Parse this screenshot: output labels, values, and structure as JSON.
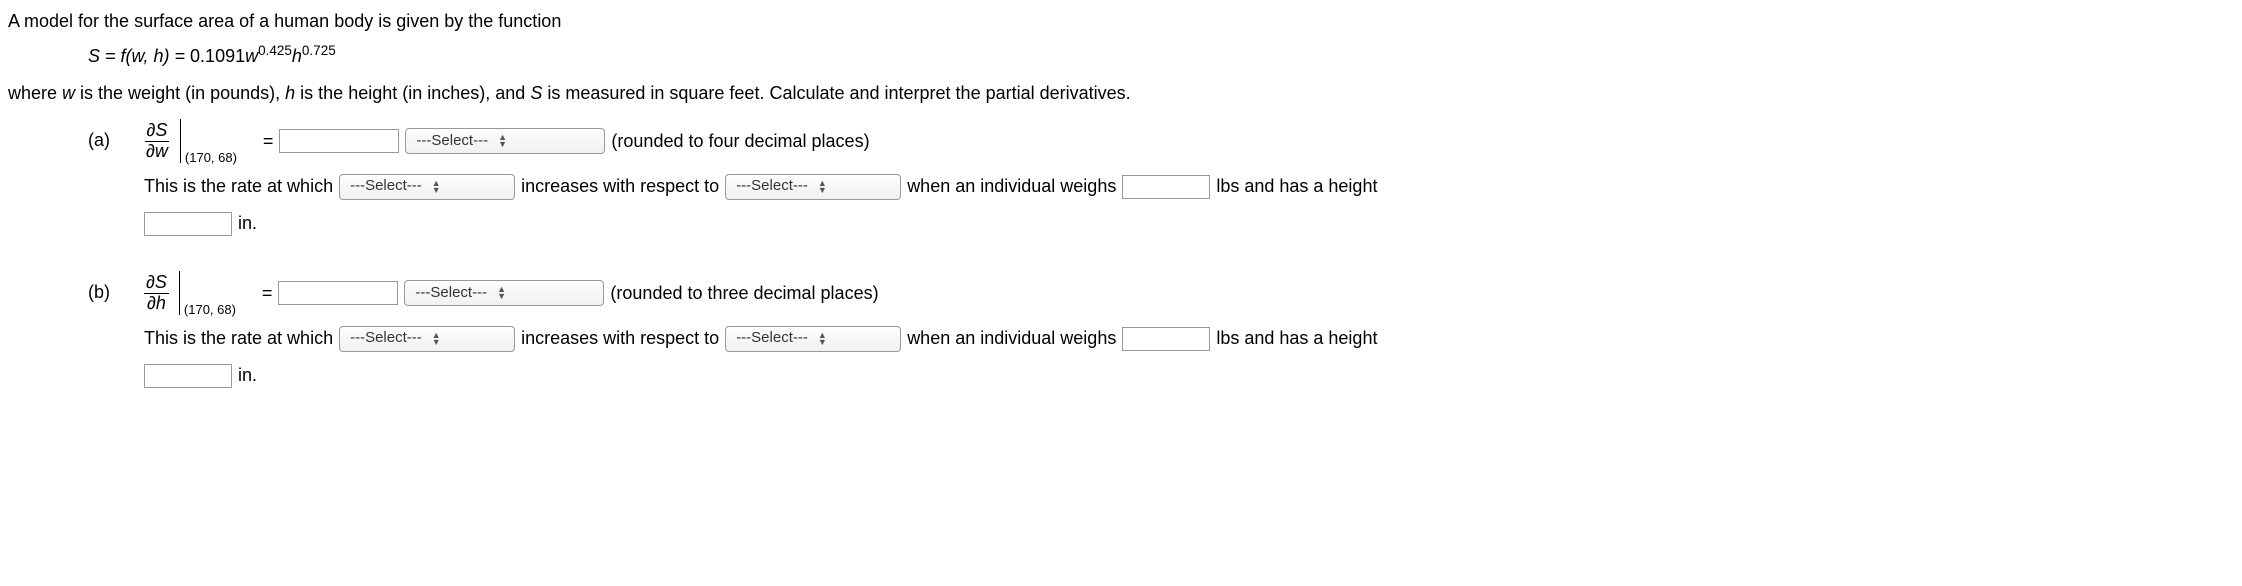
{
  "intro": "A model for the surface area of a human body is given by the function",
  "formula": {
    "lhs": "S = f(w, h) = ",
    "coef": "0.1091",
    "w": "w",
    "exp1": "0.425",
    "h": "h",
    "exp2": "0.725"
  },
  "where": {
    "t1": "where ",
    "w": "w",
    "t2": " is the weight (in pounds), ",
    "h": "h",
    "t3": " is the height (in inches), and ",
    "S": "S",
    "t4": " is measured in square feet. Calculate and interpret the partial derivatives."
  },
  "select_placeholder": "---Select---",
  "parts": {
    "a": {
      "label": "(a)",
      "num": "∂S",
      "den": "∂w",
      "point": "(170, 68)",
      "eq": "=",
      "rounded": "(rounded to four decimal places)",
      "sentence": {
        "t1": "This is the rate at which",
        "t2": "increases with respect to",
        "t3": "when an individual weighs",
        "t4": "lbs and has a height",
        "t5": "in."
      }
    },
    "b": {
      "label": "(b)",
      "num": "∂S",
      "den": "∂h",
      "point": "(170, 68)",
      "eq": "=",
      "rounded": "(rounded to three decimal places)",
      "sentence": {
        "t1": "This is the rate at which",
        "t2": "increases with respect to",
        "t3": "when an individual weighs",
        "t4": "lbs and has a height",
        "t5": "in."
      }
    }
  }
}
